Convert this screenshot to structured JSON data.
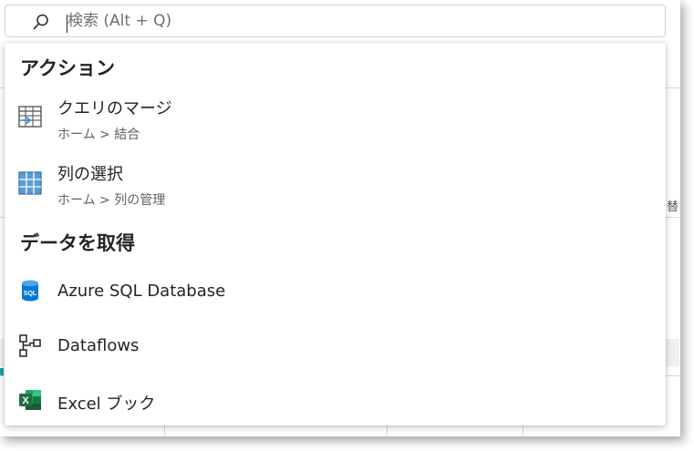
{
  "search": {
    "placeholder": "検索 (Alt + Q)",
    "value": ""
  },
  "dropdown": {
    "sections": [
      {
        "title": "アクション",
        "items": [
          {
            "label": "クエリのマージ",
            "path": "ホーム > 結合",
            "icon": "merge-queries-icon"
          },
          {
            "label": "列の選択",
            "path": "ホーム > 列の管理",
            "icon": "choose-columns-icon"
          }
        ]
      },
      {
        "title": "データを取得",
        "items": [
          {
            "label": "Azure SQL Database",
            "icon": "azure-sql-database-icon"
          },
          {
            "label": "Dataflows",
            "icon": "dataflows-icon"
          },
          {
            "label": "Excel ブック",
            "icon": "excel-workbook-icon"
          }
        ]
      }
    ]
  },
  "background": {
    "fragment_label": "替"
  },
  "colors": {
    "excel_green": "#1D6F42",
    "azure_blue": "#0078D4",
    "grid_blue": "#5B9BD5"
  }
}
